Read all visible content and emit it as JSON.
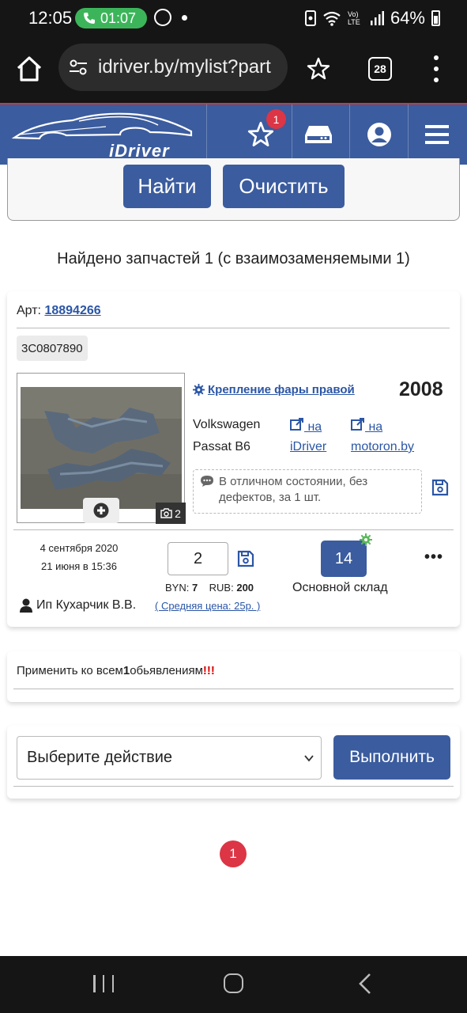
{
  "status_bar": {
    "time": "12:05",
    "call_timer": "01:07",
    "signal_label": "Vo) LTE",
    "battery": "64%"
  },
  "browser": {
    "url": "idriver.by/mylist?part",
    "tab_count": "28"
  },
  "site_header": {
    "logo_text": "iDriver",
    "favorites_count": "1"
  },
  "search_panel": {
    "find_label": "Найти",
    "clear_label": "Очистить"
  },
  "results": {
    "summary": "Найдено запчастей 1 (с взаимозаменяемыми 1)"
  },
  "part": {
    "art_label": "Арт:",
    "art_number": "18894266",
    "oem_code": "3C0807890",
    "photo_count": "2",
    "name": "Крепление фары правой",
    "year": "2008",
    "make": "Volkswagen",
    "model": "Passat B6",
    "link1_top": "на",
    "link1_bottom": "iDriver",
    "link2_top": "на",
    "link2_bottom": "motoron.by",
    "comment": "В отличном состоянии, без дефектов, за 1 шт.",
    "date_created": "4 сентября 2020",
    "date_updated": "21 июня в 15:36",
    "quantity": "2",
    "price_byn_label": "BYN:",
    "price_byn": "7",
    "price_rub_label": "RUB:",
    "price_rub": "200",
    "avg_price": "( Средняя цена: 25р. )",
    "stock_count": "14",
    "stock_name": "Основной склад",
    "more": "•••",
    "seller": "Ип Кухарчик В.В."
  },
  "apply_all": {
    "prefix": "Применить ко всем",
    "count": "1",
    "suffix": "обьявлениям",
    "marks": "!!!"
  },
  "bulk_action": {
    "select_placeholder": "Выберите действие",
    "execute_label": "Выполнить"
  },
  "pagination": {
    "current_page": "1"
  },
  "colors": {
    "brand_blue": "#3b5c9e",
    "link_blue": "#2b56a6",
    "badge_red": "#dc3545",
    "call_green": "#3cb55a"
  }
}
